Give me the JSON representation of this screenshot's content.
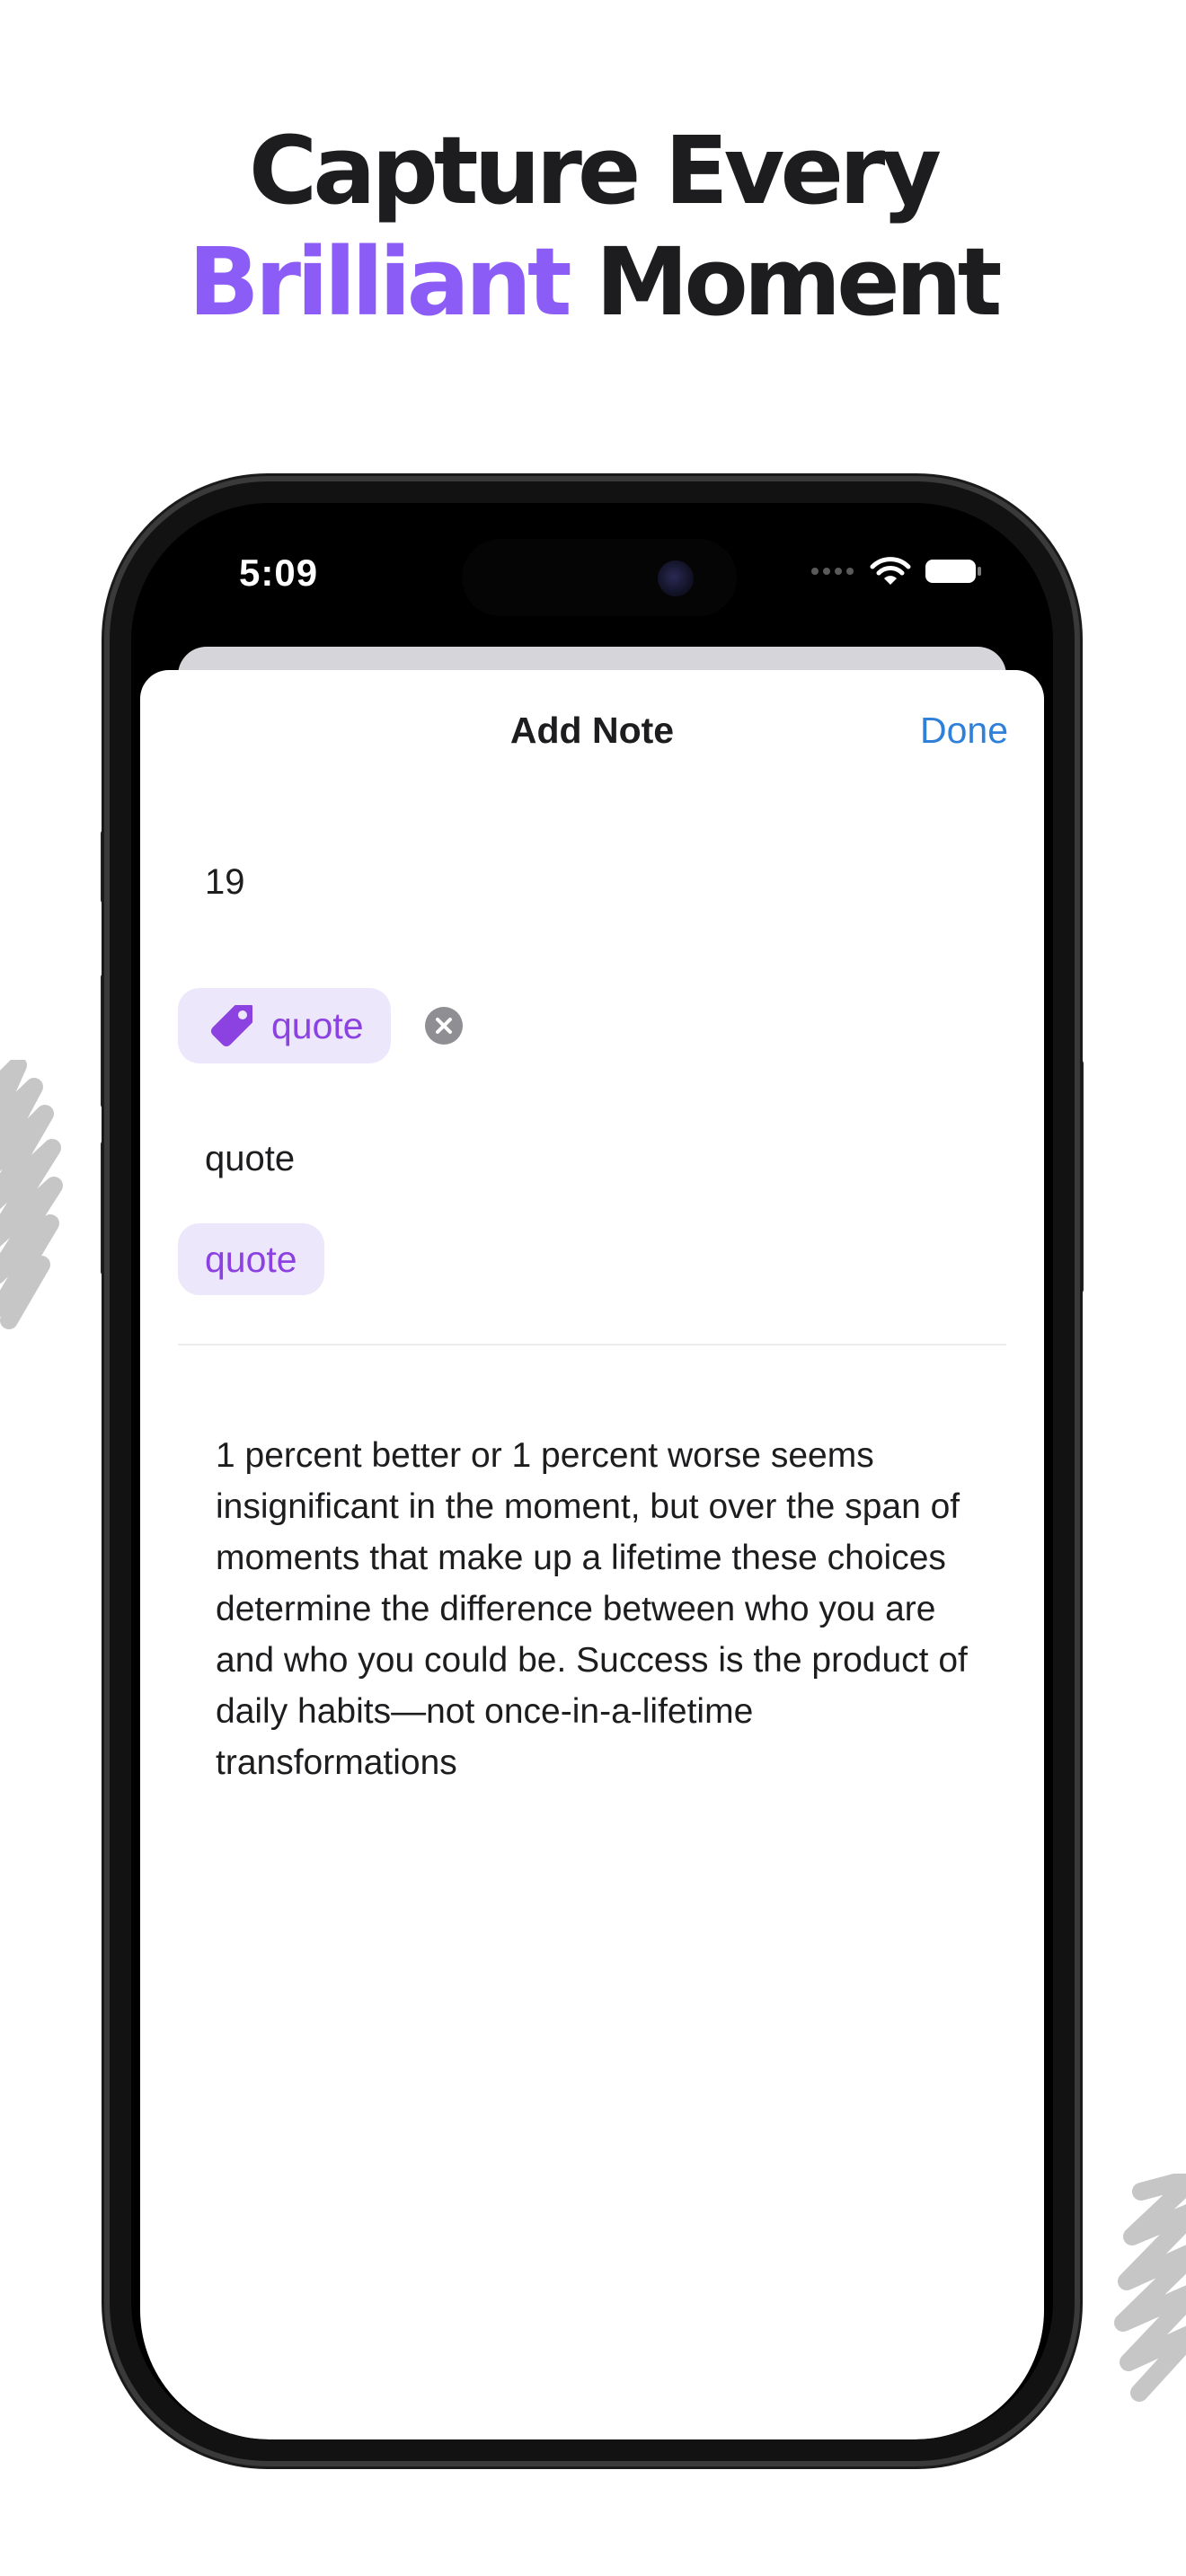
{
  "headline": {
    "line1": "Capture Every",
    "accent_word": "Brilliant",
    "line2_rest": "Moment"
  },
  "colors": {
    "accent": "#8b5cf6",
    "tag_text": "#8b42e0",
    "tag_background": "#ede7fb",
    "link": "#2f80d9"
  },
  "status_bar": {
    "time": "5:09",
    "icons": [
      "cellular-dots-icon",
      "wifi-icon",
      "battery-icon"
    ]
  },
  "sheet": {
    "title": "Add Note",
    "done_label": "Done",
    "field_value": "19",
    "tag_chip": {
      "icon": "tag-icon",
      "label": "quote"
    },
    "remove_icon": "close-circle-icon",
    "tag_input_value": "quote",
    "suggestion_chip": {
      "label": "quote"
    },
    "note_text": "1 percent better or 1 percent worse seems insignificant in the moment, but over the span of moments that make up a lifetime these choices determine the difference between who you are and who you could be. Success is the product of daily habits—not once-in-a-lifetime transformations"
  }
}
